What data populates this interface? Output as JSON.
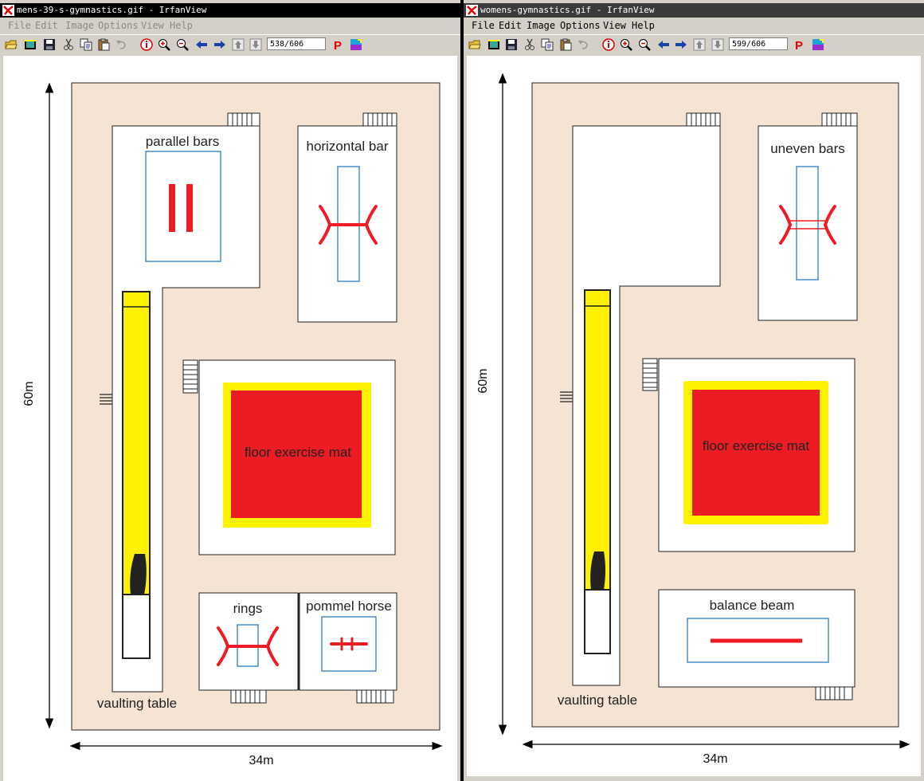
{
  "left_window": {
    "title": "mens-39-s-gymnastics.gif - IrfanView",
    "menu": [
      "File",
      "Edit",
      "Image",
      "Options",
      "View",
      "Help"
    ],
    "page_counter": "538/606",
    "diagram": {
      "length_label": "60m",
      "width_label": "34m",
      "parallel_bars": "parallel bars",
      "horizontal_bar": "horizontal bar",
      "floor_mat": "floor exercise mat",
      "rings": "rings",
      "pommel_horse": "pommel horse",
      "vaulting_table": "vaulting table"
    }
  },
  "right_window": {
    "title": "womens-gymnastics.gif - IrfanView",
    "menu": [
      "File",
      "Edit",
      "Image",
      "Options",
      "View",
      "Help"
    ],
    "page_counter": "599/606",
    "diagram": {
      "length_label": "60m",
      "width_label": "34m",
      "uneven_bars": "uneven bars",
      "floor_mat": "floor exercise mat",
      "balance_beam": "balance beam",
      "vaulting_table": "vaulting table"
    }
  },
  "toolbar_icons": [
    "open-icon",
    "slideshow-icon",
    "save-icon",
    "cut-icon",
    "copy-icon",
    "paste-icon",
    "undo-icon",
    "info-icon",
    "zoom-in-icon",
    "zoom-out-icon",
    "previous-icon",
    "next-icon",
    "first-page-icon",
    "last-page-icon",
    "print-icon",
    "paint-icon"
  ],
  "colors": {
    "venue_background": "#f5e3d3",
    "apparatus_red": "#ed1c24",
    "runway_yellow": "#fff200",
    "frame_blue": "#2b7bc2"
  }
}
